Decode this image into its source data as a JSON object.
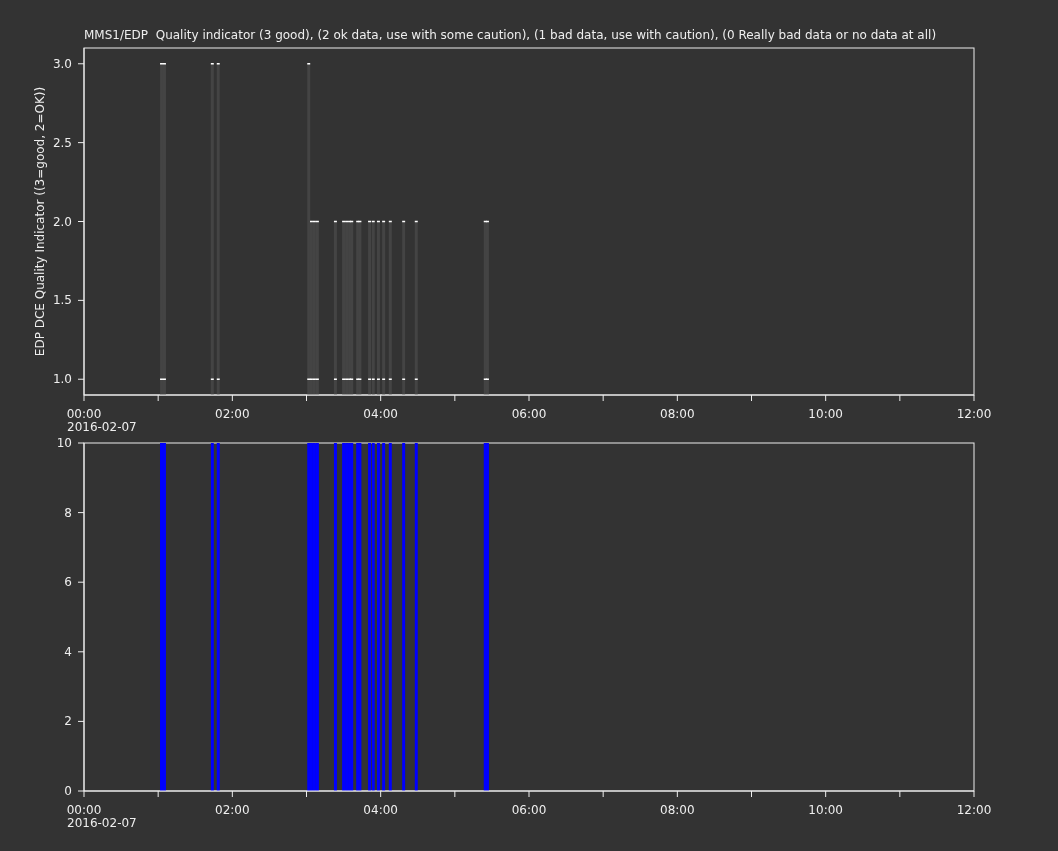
{
  "title": "MMS1/EDP  Quality indicator (3 good), (2 ok data, use with some caution), (1 bad data, use with caution), (0 Really bad data or no data at all)",
  "panels": [
    {
      "date_label": "2016-02-07",
      "caps": true,
      "chart_data": {
        "type": "bar",
        "ylabel": "EDP DCE Quality Indicator ((3=good, 2=OK))",
        "xlim": [
          0,
          12
        ],
        "ylim": [
          0.9,
          3.1
        ],
        "xticks": [
          {
            "value": 0,
            "label": "00:00"
          },
          {
            "value": 2,
            "label": "02:00"
          },
          {
            "value": 4,
            "label": "04:00"
          },
          {
            "value": 6,
            "label": "06:00"
          },
          {
            "value": 8,
            "label": "08:00"
          },
          {
            "value": 10,
            "label": "10:00"
          },
          {
            "value": 12,
            "label": "12:00"
          }
        ],
        "yticks": [
          {
            "value": 1,
            "label": "1.0"
          },
          {
            "value": 1.5,
            "label": "1.5"
          },
          {
            "value": 2,
            "label": "2.0"
          },
          {
            "value": 2.5,
            "label": "2.5"
          },
          {
            "value": 3,
            "label": "3.0"
          }
        ],
        "x": [
          1.045,
          1.085,
          1.73,
          1.81,
          3.03,
          3.067,
          3.107,
          3.147,
          3.39,
          3.5,
          3.54,
          3.58,
          3.61,
          3.69,
          3.72,
          3.85,
          3.9,
          3.97,
          4.04,
          4.13,
          4.31,
          4.48,
          5.41,
          5.44
        ],
        "series": [
          {
            "color": "#444444",
            "values": [
              3,
              3,
              3,
              3,
              3,
              2,
              2,
              2,
              2,
              2,
              2,
              2,
              2,
              2,
              2,
              2,
              2,
              2,
              2,
              2,
              2,
              2,
              2,
              2
            ]
          }
        ]
      }
    },
    {
      "date_label": "2016-02-07",
      "caps": false,
      "chart_data": {
        "type": "bar",
        "xlim": [
          0,
          12
        ],
        "ylim": [
          0,
          10
        ],
        "xticks": [
          {
            "value": 0,
            "label": "00:00"
          },
          {
            "value": 2,
            "label": "02:00"
          },
          {
            "value": 4,
            "label": "04:00"
          },
          {
            "value": 6,
            "label": "06:00"
          },
          {
            "value": 8,
            "label": "08:00"
          },
          {
            "value": 10,
            "label": "10:00"
          },
          {
            "value": 12,
            "label": "12:00"
          }
        ],
        "yticks": [
          {
            "value": 0,
            "label": "0"
          },
          {
            "value": 2,
            "label": "2"
          },
          {
            "value": 4,
            "label": "4"
          },
          {
            "value": 6,
            "label": "6"
          },
          {
            "value": 8,
            "label": "8"
          },
          {
            "value": 10,
            "label": "10"
          }
        ],
        "x": [
          1.045,
          1.085,
          1.73,
          1.81,
          3.03,
          3.067,
          3.107,
          3.147,
          3.39,
          3.5,
          3.54,
          3.58,
          3.61,
          3.69,
          3.72,
          3.85,
          3.9,
          3.97,
          4.04,
          4.13,
          4.31,
          4.48,
          5.41,
          5.44
        ],
        "series": [
          {
            "color": "#0000ff",
            "values": [
              10,
              10,
              10,
              10,
              10,
              10,
              10,
              10,
              10,
              10,
              10,
              10,
              10,
              10,
              10,
              10,
              10,
              10,
              10,
              10,
              10,
              10,
              10,
              10
            ]
          }
        ]
      }
    }
  ]
}
